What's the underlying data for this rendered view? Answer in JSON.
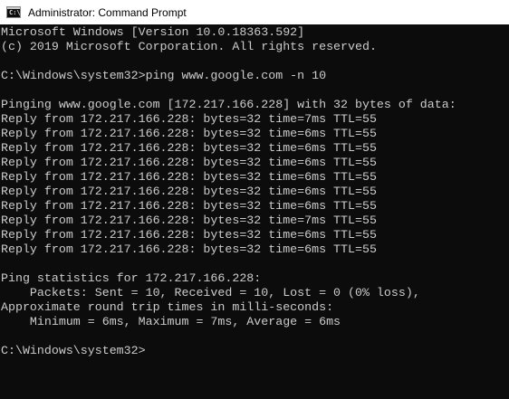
{
  "window": {
    "title": "Administrator: Command Prompt",
    "icon": "command-prompt-icon",
    "icon_glyph": "C:\\"
  },
  "colors": {
    "background": "#0c0c0c",
    "foreground": "#cccccc",
    "titlebar": "#ffffff"
  },
  "console": {
    "lines": [
      "Microsoft Windows [Version 10.0.18363.592]",
      "(c) 2019 Microsoft Corporation. All rights reserved.",
      "",
      "C:\\Windows\\system32>ping www.google.com -n 10",
      "",
      "Pinging www.google.com [172.217.166.228] with 32 bytes of data:",
      "Reply from 172.217.166.228: bytes=32 time=7ms TTL=55",
      "Reply from 172.217.166.228: bytes=32 time=6ms TTL=55",
      "Reply from 172.217.166.228: bytes=32 time=6ms TTL=55",
      "Reply from 172.217.166.228: bytes=32 time=6ms TTL=55",
      "Reply from 172.217.166.228: bytes=32 time=6ms TTL=55",
      "Reply from 172.217.166.228: bytes=32 time=6ms TTL=55",
      "Reply from 172.217.166.228: bytes=32 time=6ms TTL=55",
      "Reply from 172.217.166.228: bytes=32 time=7ms TTL=55",
      "Reply from 172.217.166.228: bytes=32 time=6ms TTL=55",
      "Reply from 172.217.166.228: bytes=32 time=6ms TTL=55",
      "",
      "Ping statistics for 172.217.166.228:",
      "    Packets: Sent = 10, Received = 10, Lost = 0 (0% loss),",
      "Approximate round trip times in milli-seconds:",
      "    Minimum = 6ms, Maximum = 7ms, Average = 6ms",
      "",
      "C:\\Windows\\system32>"
    ]
  }
}
